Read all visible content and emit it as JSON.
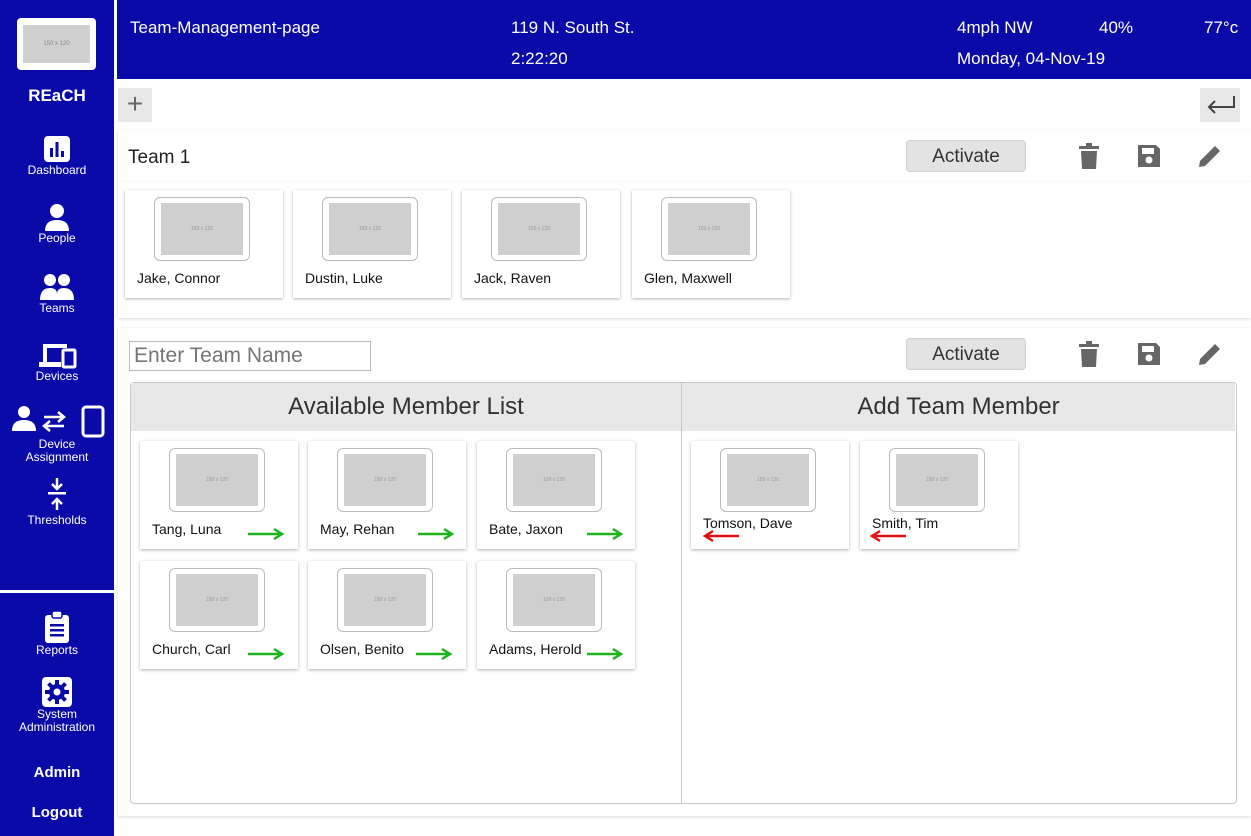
{
  "sidebar": {
    "logo_text": "150 x 120",
    "brand": "REaCH",
    "items": [
      {
        "label": "Dashboard",
        "icon": "bar-chart-icon"
      },
      {
        "label": "People",
        "icon": "person-icon"
      },
      {
        "label": "Teams",
        "icon": "group-icon"
      },
      {
        "label": "Devices",
        "icon": "devices-icon"
      },
      {
        "label": "Device",
        "label2": "Assignment",
        "icon": "device-assignment-icon"
      },
      {
        "label": "Thresholds",
        "icon": "thresholds-icon"
      },
      {
        "label": "Reports",
        "icon": "clipboard-icon"
      },
      {
        "label": "System",
        "label2": "Administration",
        "icon": "gear-icon"
      }
    ],
    "admin": "Admin",
    "logout": "Logout"
  },
  "header": {
    "title": "Team-Management-page",
    "address": "119 N. South St.",
    "time": "2:22:20",
    "wind": "4mph NW",
    "humidity": "40%",
    "temperature": "77°c",
    "date": "Monday, 04-Nov-19"
  },
  "toolbar": {
    "add_label": "+"
  },
  "team1": {
    "name": "Team 1",
    "activate_label": "Activate",
    "members": [
      {
        "name": "Jake, Connor",
        "thumb": "150 x 120"
      },
      {
        "name": "Dustin, Luke",
        "thumb": "150 x 120"
      },
      {
        "name": "Jack, Raven",
        "thumb": "150 x 120"
      },
      {
        "name": "Glen, Maxwell",
        "thumb": "150 x 120"
      }
    ]
  },
  "new_team": {
    "name_placeholder": "Enter Team Name",
    "activate_label": "Activate",
    "available_header": "Available Member List",
    "add_header": "Add Team Member",
    "available": [
      {
        "name": "Tang, Luna",
        "thumb": "150 x 120"
      },
      {
        "name": "May, Rehan",
        "thumb": "150 x 120"
      },
      {
        "name": "Bate, Jaxon",
        "thumb": "150 x 120"
      },
      {
        "name": "Church, Carl",
        "thumb": "150 x 120"
      },
      {
        "name": "Olsen, Benito",
        "thumb": "150 x 120"
      },
      {
        "name": "Adams, Herold",
        "thumb": "150 x 120"
      }
    ],
    "added": [
      {
        "name": "Tomson, Dave",
        "thumb": "150 x 120"
      },
      {
        "name": "Smith, Tim",
        "thumb": "150 x 120"
      }
    ]
  },
  "colors": {
    "brand_blue": "#0a0aa8",
    "add_arrow": "#1db31d",
    "remove_arrow": "#e01010",
    "icon_gray": "#666666"
  }
}
